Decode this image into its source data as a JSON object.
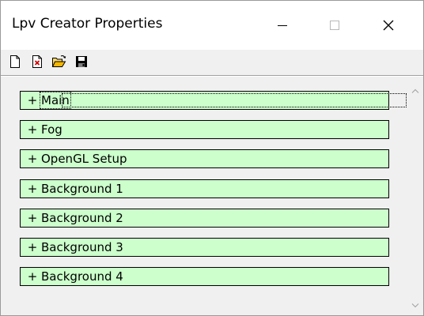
{
  "window": {
    "title": "Lpv Creator Properties",
    "controls": {
      "minimize": "minimize",
      "maximize": "maximize",
      "close": "close"
    }
  },
  "toolbar": {
    "buttons": [
      {
        "name": "new",
        "icon": "new-document-icon"
      },
      {
        "name": "close",
        "icon": "close-document-icon"
      },
      {
        "name": "open",
        "icon": "open-folder-icon"
      },
      {
        "name": "save",
        "icon": "floppy-disk-icon"
      }
    ]
  },
  "sections": [
    {
      "expander": "+",
      "label": "Main",
      "focused": true
    },
    {
      "expander": "+",
      "label": "Fog"
    },
    {
      "expander": "+",
      "label": "OpenGL Setup"
    },
    {
      "expander": "+",
      "label": "Background 1"
    },
    {
      "expander": "+",
      "label": "Background 2"
    },
    {
      "expander": "+",
      "label": "Background 3"
    },
    {
      "expander": "+",
      "label": "Background 4"
    }
  ],
  "colors": {
    "section_bg": "#ccffcc",
    "section_border": "#000000",
    "window_bg": "#f0f0f0",
    "titlebar_bg": "#ffffff"
  }
}
